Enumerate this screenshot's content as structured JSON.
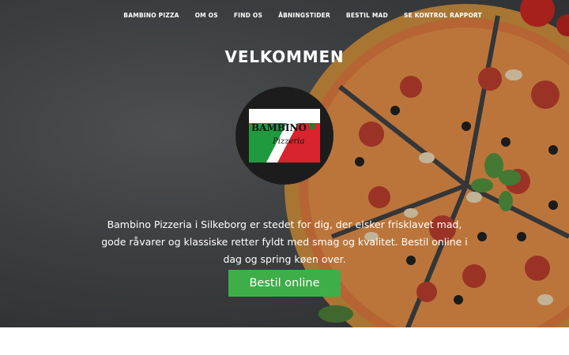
{
  "nav": {
    "items": [
      {
        "label": "BAMBINO PIZZA"
      },
      {
        "label": "OM OS"
      },
      {
        "label": "FIND OS"
      },
      {
        "label": "ÅBNINGSTIDER"
      },
      {
        "label": "BESTIL MAD"
      },
      {
        "label": "SE KONTROL RAPPORT"
      }
    ]
  },
  "hero": {
    "title": "VELKOMMEN",
    "tagline": "Bambino Pizzeria i Silkeborg er stedet for dig, der elsker frisklavet mad, gode råvarer og klassiske retter fyldt med smag og kvalitet. Bestil online i dag og spring køen over.",
    "cta_label": "Bestil online"
  },
  "logo": {
    "brand": "BAMBINO",
    "sub": "Pizzeria"
  },
  "colors": {
    "accent": "#3eae48",
    "flag_green": "#1f9a3e",
    "flag_red": "#d9232e"
  }
}
